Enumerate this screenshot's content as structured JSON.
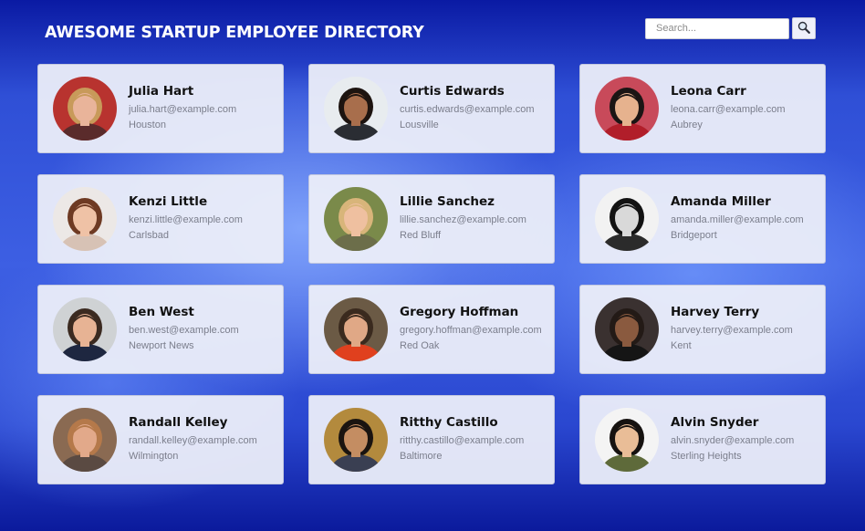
{
  "header": {
    "title": "AWESOME STARTUP EMPLOYEE DIRECTORY",
    "search": {
      "placeholder": "Search...",
      "value": "",
      "button_icon": "magnifier-icon"
    }
  },
  "employees": [
    {
      "name": "Julia Hart",
      "email": "julia.hart@example.com",
      "city": "Houston",
      "avatar": {
        "bg": "#b8332f",
        "skin": "#e9b49a",
        "hair": "#c89a5a",
        "shirt": "#5a2b2b"
      }
    },
    {
      "name": "Curtis Edwards",
      "email": "curtis.edwards@example.com",
      "city": "Lousville",
      "avatar": {
        "bg": "#e8ecef",
        "skin": "#a86e4c",
        "hair": "#1d1410",
        "shirt": "#2a2d33"
      }
    },
    {
      "name": "Leona Carr",
      "email": "leona.carr@example.com",
      "city": "Aubrey",
      "avatar": {
        "bg": "#c84a5a",
        "skin": "#e6b28e",
        "hair": "#1b1514",
        "shirt": "#b11e2a"
      }
    },
    {
      "name": "Kenzi Little",
      "email": "kenzi.little@example.com",
      "city": "Carlsbad",
      "avatar": {
        "bg": "#ece8e6",
        "skin": "#efc2a6",
        "hair": "#6e3a23",
        "shirt": "#d7c2b5"
      }
    },
    {
      "name": "Lillie Sanchez",
      "email": "lillie.sanchez@example.com",
      "city": "Red Bluff",
      "avatar": {
        "bg": "#7a8a4a",
        "skin": "#efc0a0",
        "hair": "#d8b57a",
        "shirt": "#6c6e4a"
      }
    },
    {
      "name": "Amanda Miller",
      "email": "amanda.miller@example.com",
      "city": "Bridgeport",
      "avatar": {
        "bg": "#f2f2f2",
        "skin": "#d9d9d9",
        "hair": "#121212",
        "shirt": "#2b2b2b"
      }
    },
    {
      "name": "Ben West",
      "email": "ben.west@example.com",
      "city": "Newport News",
      "avatar": {
        "bg": "#cfd2d4",
        "skin": "#e7b394",
        "hair": "#3b2a20",
        "shirt": "#1e2740"
      }
    },
    {
      "name": "Gregory Hoffman",
      "email": "gregory.hoffman@example.com",
      "city": "Red Oak",
      "avatar": {
        "bg": "#6b5a45",
        "skin": "#e0a886",
        "hair": "#3a2a1e",
        "shirt": "#e0401e"
      }
    },
    {
      "name": "Harvey Terry",
      "email": "harvey.terry@example.com",
      "city": "Kent",
      "avatar": {
        "bg": "#3a3130",
        "skin": "#8a5a3f",
        "hair": "#231a16",
        "shirt": "#151515"
      }
    },
    {
      "name": "Randall Kelley",
      "email": "randall.kelley@example.com",
      "city": "Wilmington",
      "avatar": {
        "bg": "#8a6a52",
        "skin": "#e2a98a",
        "hair": "#b5794a",
        "shirt": "#5a4a42"
      }
    },
    {
      "name": "Ritthy Castillo",
      "email": "ritthy.castillo@example.com",
      "city": "Baltimore",
      "avatar": {
        "bg": "#b38a3d",
        "skin": "#c48d62",
        "hair": "#1a1410",
        "shirt": "#3a3f52"
      }
    },
    {
      "name": "Alvin Snyder",
      "email": "alvin.snyder@example.com",
      "city": "Sterling Heights",
      "avatar": {
        "bg": "#f4f4f4",
        "skin": "#e9bd97",
        "hair": "#161210",
        "shirt": "#5e6a3a"
      }
    }
  ]
}
